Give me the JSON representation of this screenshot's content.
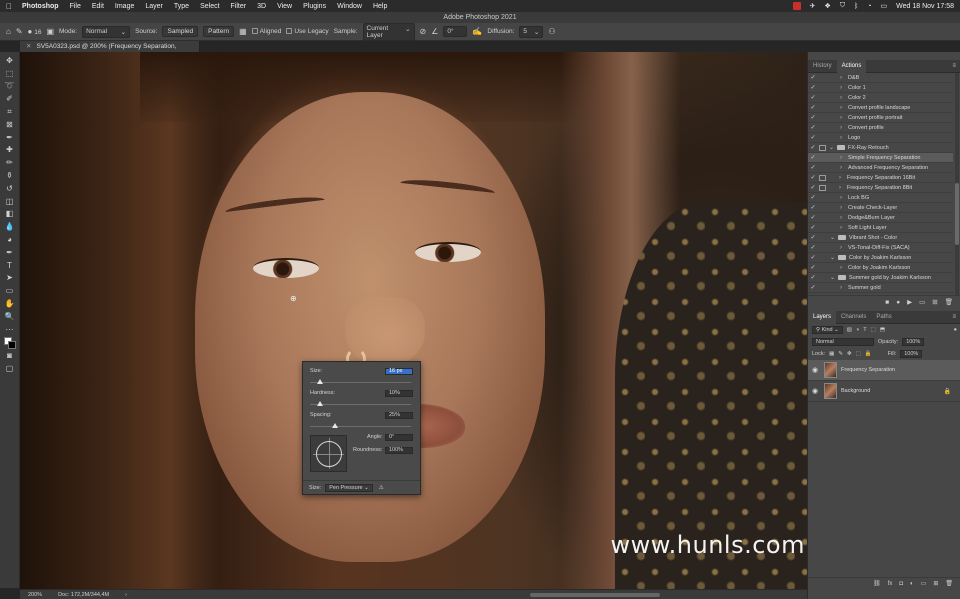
{
  "menubar": {
    "apple": "",
    "app": "Photoshop",
    "items": [
      "File",
      "Edit",
      "Image",
      "Layer",
      "Type",
      "Select",
      "Filter",
      "3D",
      "View",
      "Plugins",
      "Window",
      "Help"
    ],
    "datetime": "Wed 18 Nov  17:58"
  },
  "window": {
    "title": "Adobe Photoshop 2021"
  },
  "options": {
    "mode_label": "Mode:",
    "mode_value": "Normal",
    "source_label": "Source:",
    "sampled": "Sampled",
    "pattern": "Pattern",
    "aligned": "Aligned",
    "use_legacy": "Use Legacy",
    "sample_label": "Sample:",
    "sample_value": "Current Layer",
    "angle_value": "0°",
    "diffusion_label": "Diffusion:",
    "diffusion_value": "5",
    "brush_size": "16"
  },
  "document": {
    "tab_title": "SV5A0323.psd @ 200% (Frequency Separation, RGB/16*) *"
  },
  "canvas": {
    "watermark": "www.hunls.com"
  },
  "brush_popup": {
    "size_label": "Size:",
    "size_value": "16 px",
    "size_level": 0.1,
    "hardness_label": "Hardness:",
    "hardness_value": "10%",
    "hardness_level": 0.1,
    "spacing_label": "Spacing:",
    "spacing_value": "25%",
    "spacing_level": 0.25,
    "angle_label": "Angle:",
    "angle_value": "0°",
    "roundness_label": "Roundness:",
    "roundness_value": "100%",
    "footer_size_label": "Size:",
    "footer_size_value": "Pen Pressure"
  },
  "actions_panel": {
    "tabs": [
      "History",
      "Actions"
    ],
    "active_tab": "Actions",
    "items": [
      {
        "name": "D&B",
        "checked": true,
        "dialog": false,
        "kind": "action"
      },
      {
        "name": "Color 1",
        "checked": true,
        "dialog": false,
        "kind": "action"
      },
      {
        "name": "Color 2",
        "checked": true,
        "dialog": false,
        "kind": "action"
      },
      {
        "name": "Convert profile landscape",
        "checked": true,
        "dialog": false,
        "kind": "action"
      },
      {
        "name": "Convert profile portrait",
        "checked": true,
        "dialog": false,
        "kind": "action"
      },
      {
        "name": "Convert profile",
        "checked": true,
        "dialog": false,
        "kind": "action"
      },
      {
        "name": "Logo",
        "checked": true,
        "dialog": false,
        "kind": "action"
      },
      {
        "name": "FX-Ray Retouch",
        "checked": true,
        "dialog": true,
        "kind": "set"
      },
      {
        "name": "Simple Frequency Separation",
        "checked": true,
        "dialog": false,
        "kind": "action",
        "selected": true
      },
      {
        "name": "Advanced Frequency Separation",
        "checked": true,
        "dialog": false,
        "kind": "action"
      },
      {
        "name": "Frequency Separation 16Bit",
        "checked": true,
        "dialog": true,
        "kind": "action"
      },
      {
        "name": "Frequency Separation 8Bit",
        "checked": true,
        "dialog": true,
        "kind": "action"
      },
      {
        "name": "Lock BG",
        "checked": true,
        "dialog": false,
        "kind": "action"
      },
      {
        "name": "Create Check-Layer",
        "checked": true,
        "dialog": false,
        "kind": "action"
      },
      {
        "name": "Dodge&Burn Layer",
        "checked": true,
        "dialog": false,
        "kind": "action"
      },
      {
        "name": "Soft Light Layer",
        "checked": true,
        "dialog": false,
        "kind": "action"
      },
      {
        "name": "Vibrant Shot - Color",
        "checked": true,
        "dialog": false,
        "kind": "set"
      },
      {
        "name": "VS-Tonal-Diff-Fix (SACA)",
        "checked": true,
        "dialog": false,
        "kind": "action"
      },
      {
        "name": "Color by Joakim Karlsson",
        "checked": true,
        "dialog": false,
        "kind": "set"
      },
      {
        "name": "Color by Joakim Karlsson",
        "checked": true,
        "dialog": false,
        "kind": "action"
      },
      {
        "name": "Summer gold by Joakim Karlsson",
        "checked": true,
        "dialog": false,
        "kind": "set"
      },
      {
        "name": "Summer gold",
        "checked": true,
        "dialog": false,
        "kind": "action"
      }
    ]
  },
  "layers_panel": {
    "tabs": [
      "Layers",
      "Channels",
      "Paths"
    ],
    "active_tab": "Layers",
    "filter": "Kind",
    "blend_mode": "Normal",
    "opacity_label": "Opacity:",
    "opacity_value": "100%",
    "lock_label": "Lock:",
    "fill_label": "Fill:",
    "fill_value": "100%",
    "layers": [
      {
        "name": "Frequency Separation",
        "visible": true,
        "active": true,
        "locked": false
      },
      {
        "name": "Background",
        "visible": true,
        "active": false,
        "locked": true
      }
    ]
  },
  "status": {
    "zoom": "200%",
    "doc": "Doc: 172,2M/344,4M"
  }
}
